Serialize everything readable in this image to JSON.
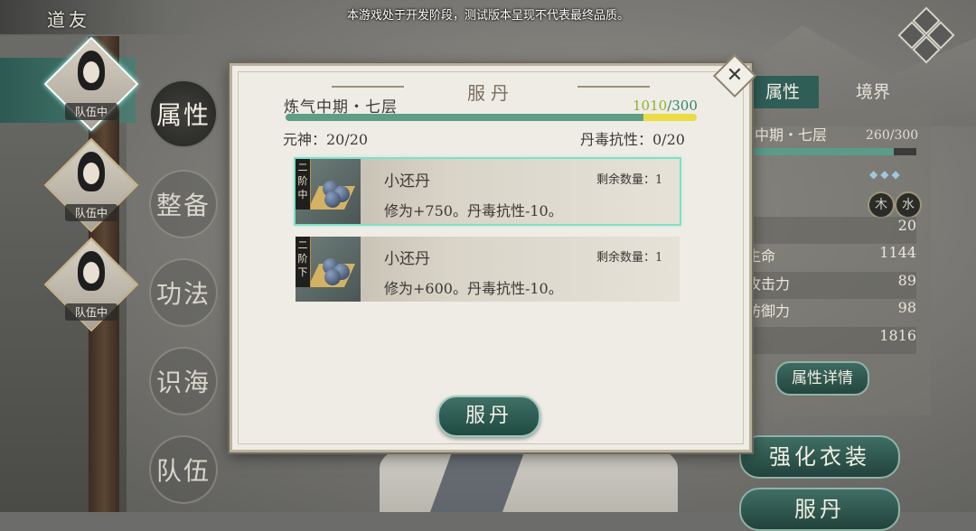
{
  "notice": "本游戏处于开发阶段，测试版本呈现不代表最终品质。",
  "page_title": "道友",
  "party": [
    {
      "tag": "队伍中"
    },
    {
      "tag": "队伍中"
    },
    {
      "tag": "队伍中"
    }
  ],
  "side_tabs": [
    "属性",
    "整备",
    "功法",
    "识海",
    "队伍"
  ],
  "right_panel": {
    "tabs": [
      "属性",
      "境界"
    ],
    "realm": "中期・七层",
    "exp": "260/300",
    "exp_progress": 0.867,
    "rows": [
      {
        "label": "",
        "value": "20"
      },
      {
        "label": "生命",
        "value": "1144"
      },
      {
        "label": "攻击力",
        "value": "89"
      },
      {
        "label": "防御力",
        "value": "98"
      },
      {
        "label": "",
        "value": "1816"
      }
    ],
    "elements": [
      "木",
      "水"
    ],
    "detail_button": "属性详情",
    "enhance_button": "强化衣装",
    "eat_button": "服丹"
  },
  "modal": {
    "title": "服丹",
    "realm": "炼气中期・七层",
    "exp_current": "1010",
    "exp_max": "/300",
    "exp_progress": 1.0,
    "spirit": "元神：20/20",
    "resistance": "丹毒抗性：0/20",
    "items": [
      {
        "grade": [
          "二",
          "阶",
          "中"
        ],
        "name": "小还丹",
        "qty": "剩余数量：1",
        "desc": "修为+750。丹毒抗性-10。",
        "selected": true
      },
      {
        "grade": [
          "二",
          "阶",
          "下"
        ],
        "name": "小还丹",
        "qty": "剩余数量：1",
        "desc": "修为+600。丹毒抗性-10。",
        "selected": false
      }
    ],
    "confirm_button": "服丹",
    "close_symbol": "✕"
  },
  "colors": {
    "accent": "#2f5e56",
    "exp_fill": "#5f9d86",
    "exp_overflow": "#eadc45",
    "selected_outline": "#7fe0c8"
  }
}
